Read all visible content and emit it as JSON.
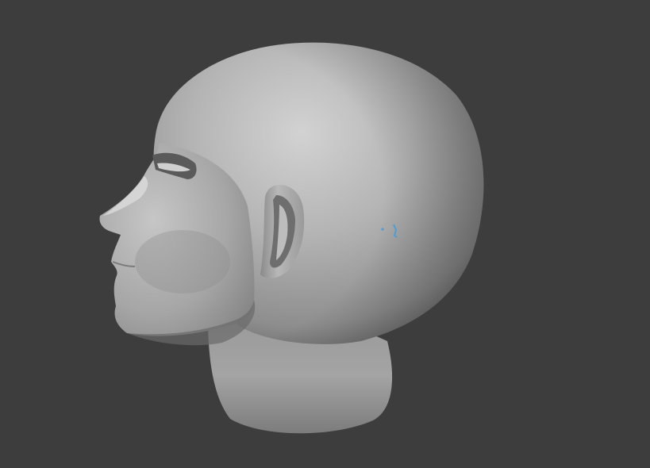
{
  "viewport": {
    "background_color": "#3d3d3d",
    "mesh_base_color": "#a8a8a8",
    "mesh_highlight_color": "#d4d4d4",
    "mesh_shadow_color": "#5e5e5e",
    "selection_marker_color": "#4a9fd8",
    "model": "sculpted-head-mesh"
  }
}
